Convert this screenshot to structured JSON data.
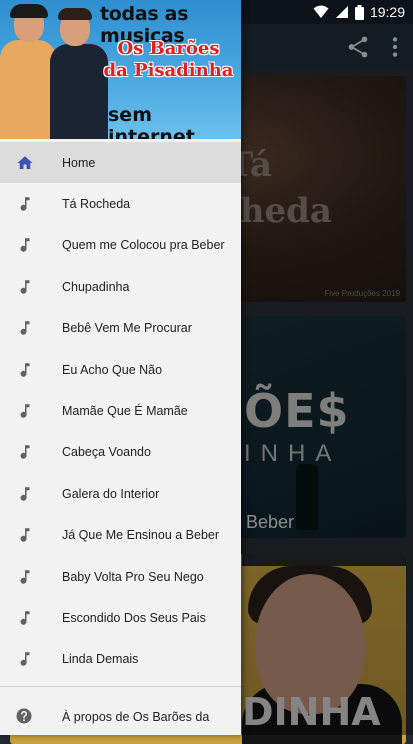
{
  "status_bar": {
    "time": "19:29"
  },
  "header": {
    "line1": "todas as musicas",
    "band_line1": "Os Barões",
    "band_line2": "da Pisadinha",
    "line3": "sem internet"
  },
  "menu": {
    "items": [
      {
        "label": "Home",
        "icon": "home-icon",
        "active": true
      },
      {
        "label": "Tá Rocheda",
        "icon": "music-note-icon"
      },
      {
        "label": "Quem me Colocou pra Beber",
        "icon": "music-note-icon"
      },
      {
        "label": "Chupadinha",
        "icon": "music-note-icon"
      },
      {
        "label": "Bebê Vem Me Procurar",
        "icon": "music-note-icon"
      },
      {
        "label": "Eu Acho Que Não",
        "icon": "music-note-icon"
      },
      {
        "label": "Mamãe Que É Mamãe",
        "icon": "music-note-icon"
      },
      {
        "label": "Cabeça Voando",
        "icon": "music-note-icon"
      },
      {
        "label": "Galera do Interior",
        "icon": "music-note-icon"
      },
      {
        "label": "Já Que Me Ensinou a Beber",
        "icon": "music-note-icon"
      },
      {
        "label": "Baby Volta Pro Seu Nego",
        "icon": "music-note-icon"
      },
      {
        "label": "Escondido Dos Seus Pais",
        "icon": "music-note-icon"
      },
      {
        "label": "Linda Demais",
        "icon": "music-note-icon"
      }
    ],
    "about_label": "À propos de Os Barões da"
  },
  "background_cards": {
    "card1_title_line1": "Tá",
    "card1_title_line2": "Rocheda",
    "card1_credit": "Five Produções 2019",
    "card2_big": "ÕE$",
    "card2_small": "INHA",
    "card2_bottom": "Beber",
    "card3_word": "DINHA"
  },
  "colors": {
    "drawer_bg": "#f2f2f2",
    "active_item_bg": "#dcdcdc",
    "home_icon": "#3f51b5",
    "note_icon": "#616161",
    "toolbar": "#233240"
  }
}
